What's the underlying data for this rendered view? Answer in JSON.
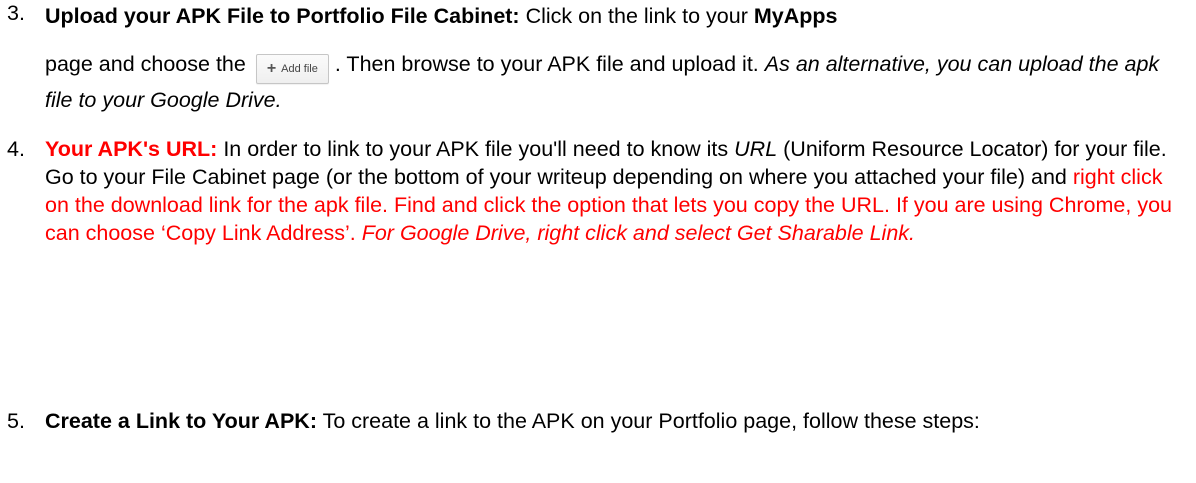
{
  "steps": [
    {
      "number": "3.",
      "title": "Upload your APK File to Portfolio File Cabinet:",
      "text_a": " Click on the link to your ",
      "myapps": "MyApps",
      "text_b": "page and choose the",
      "add_file_label": "Add file",
      "text_c": ". Then browse to your APK file and upload it. ",
      "italic_note": "As an alternative, you can upload the apk file to your Google Drive."
    },
    {
      "number": "4.",
      "title": "Your APK's URL:",
      "text_a": " In order to link to your APK file you'll need to know its ",
      "url_italic": "URL",
      "text_b": " (Uniform Resource Locator) for your file. Go to your File Cabinet page (or the bottom of your writeup depending on where you attached your file) and ",
      "red_text": "right click on the download link for the apk file. Find and click the option that lets you copy the URL. If you are using Chrome, you can choose ‘Copy Link Address’. ",
      "italic_note": "For Google Drive, right click and select Get Sharable Link."
    },
    {
      "number": "5.",
      "title": "Create a Link to Your APK:",
      "text_a": " To create a link to the APK on your Portfolio page, follow these steps:"
    }
  ],
  "colors": {
    "highlight": "#ff0000",
    "text": "#000000"
  },
  "icons": {
    "add_file": "plus-icon"
  }
}
